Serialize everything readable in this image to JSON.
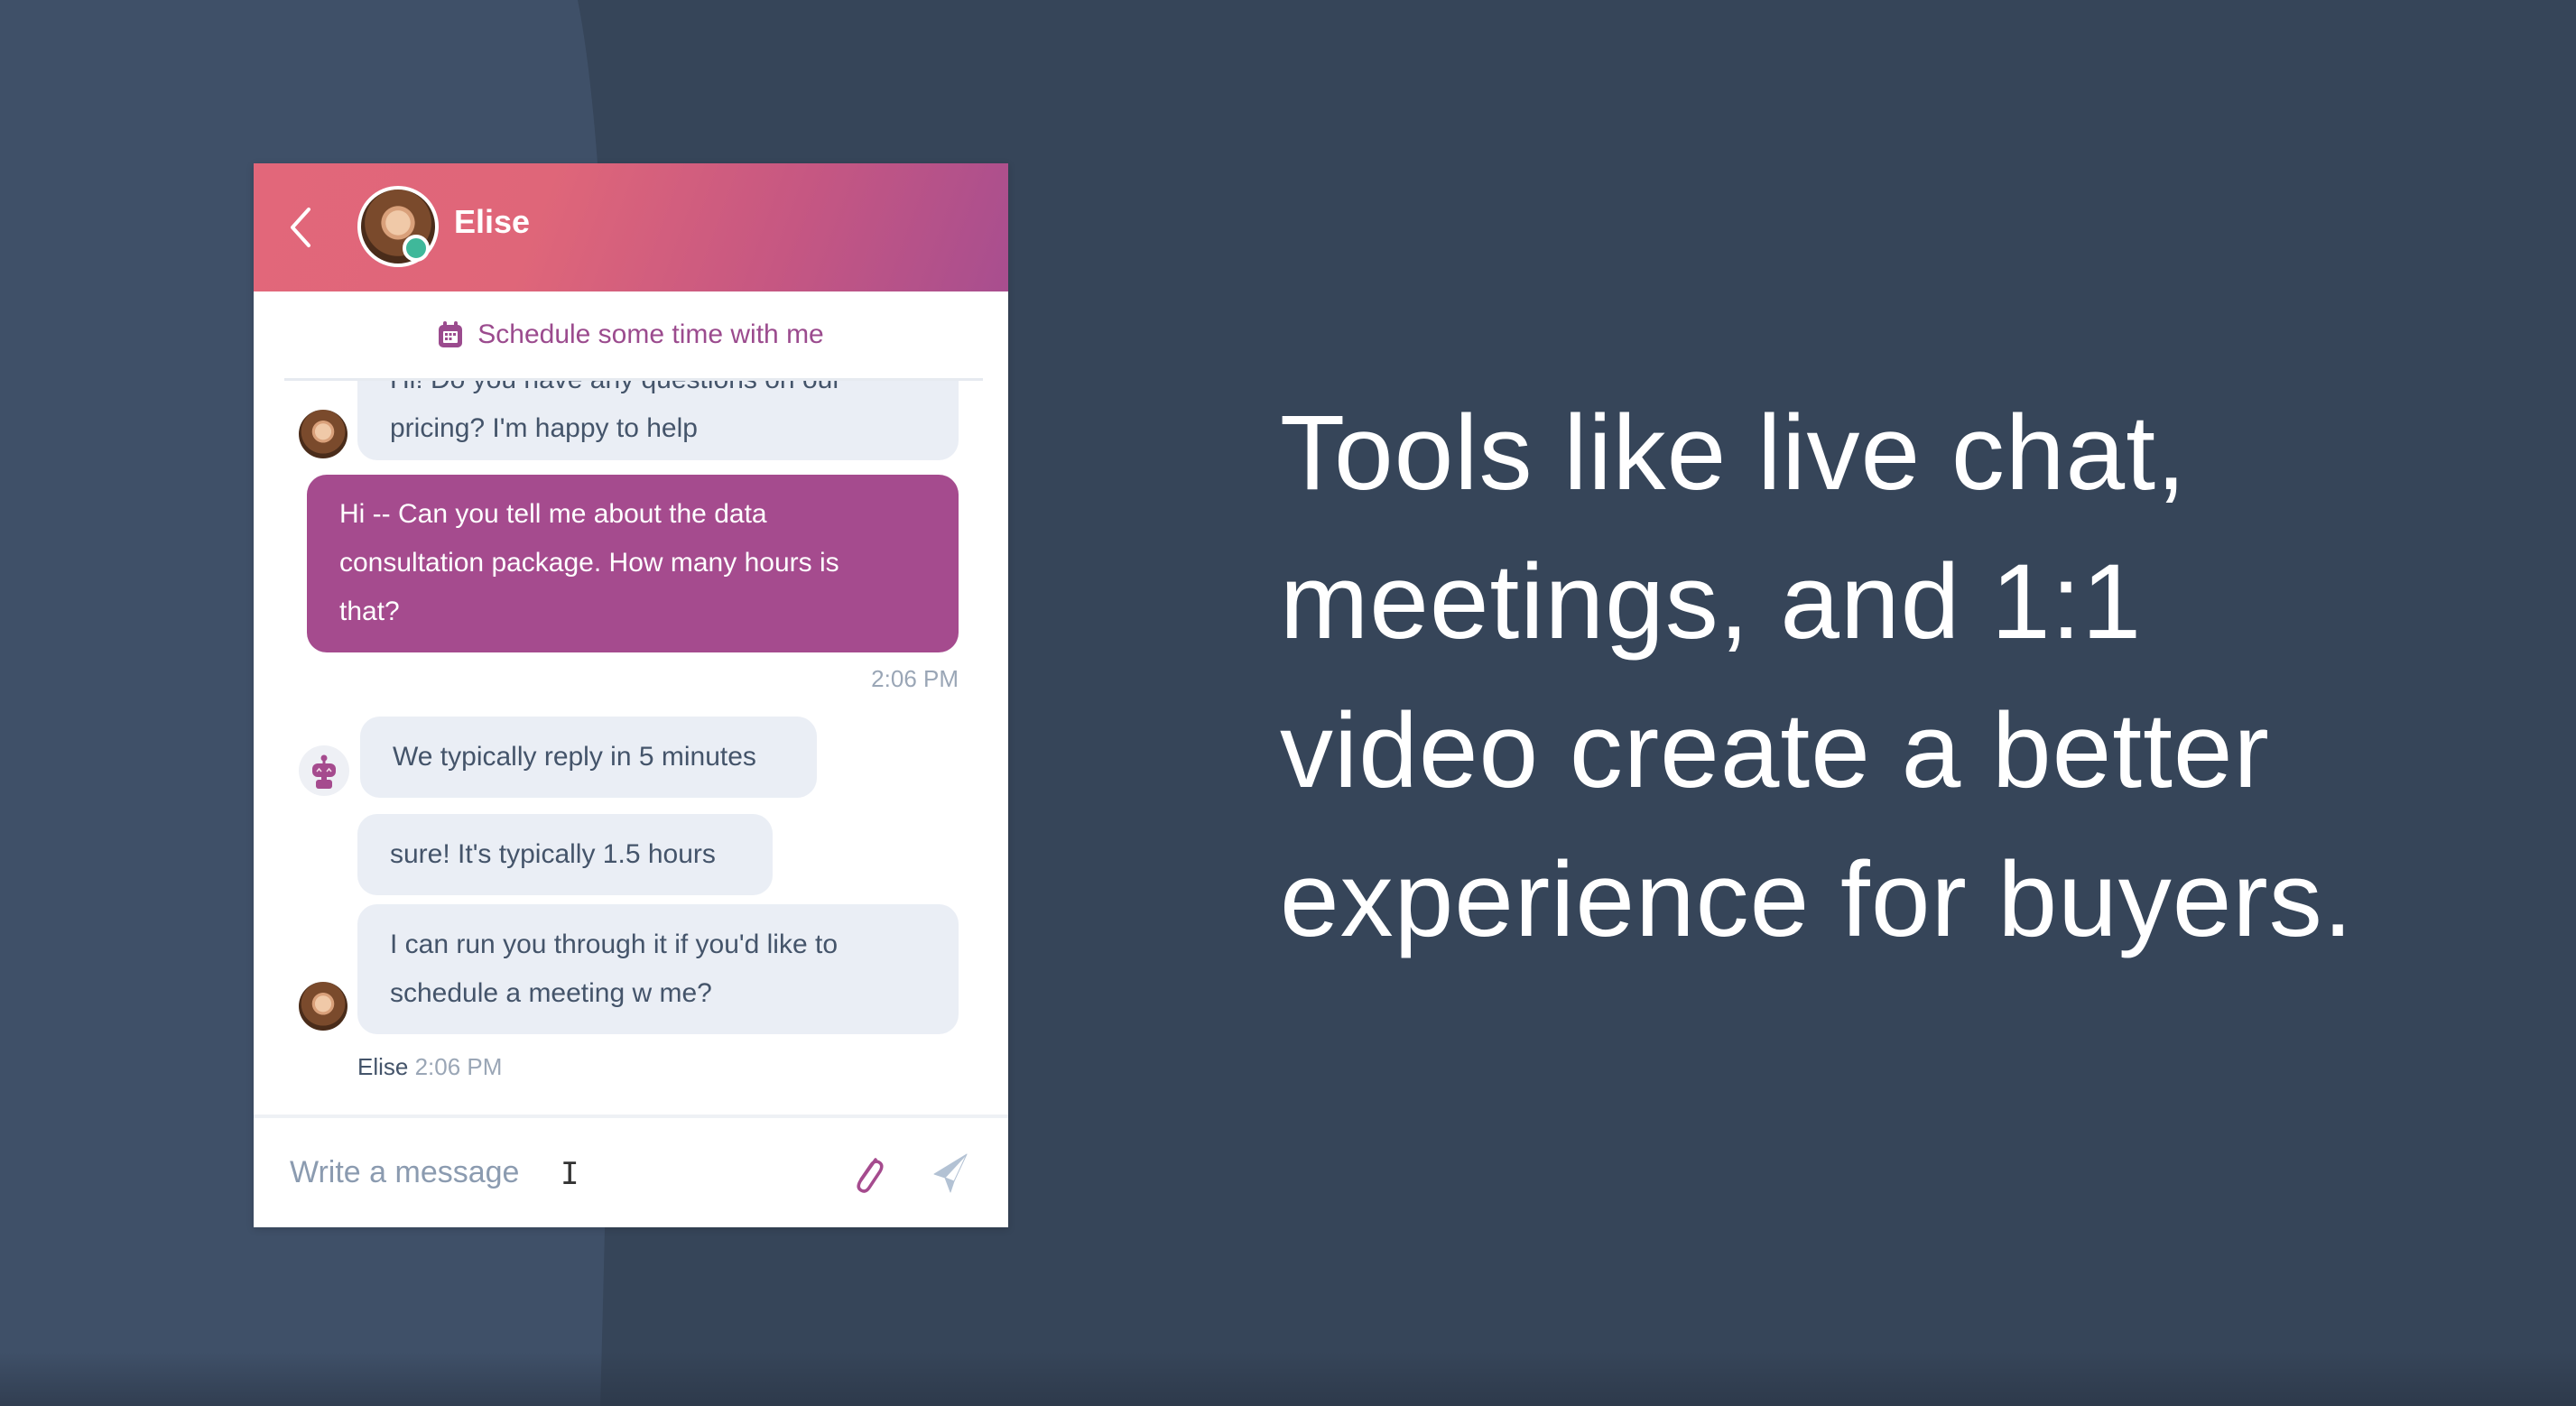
{
  "colors": {
    "background_left": "#3f5068",
    "background_right": "#364559",
    "header_gradient_start": "#e2677a",
    "header_gradient_end": "#a84e8f",
    "accent_purple": "#a54b8e",
    "status_online": "#3fb89a",
    "bubble_incoming": "#eaeef5",
    "text_dark": "#44546a",
    "text_muted": "#9aa6b6"
  },
  "chat": {
    "header": {
      "back_icon": "chevron-left-icon",
      "agent_name": "Elise",
      "status": "online"
    },
    "schedule": {
      "icon": "calendar-icon",
      "label": "Schedule some time with me"
    },
    "messages": [
      {
        "sender": "agent",
        "lines": [
          "Hi! Do you have any questions on our",
          "pricing? I'm happy to help"
        ]
      },
      {
        "sender": "visitor",
        "lines": [
          "Hi -- Can you tell me about the data",
          "consultation package. How many hours is",
          "that?"
        ],
        "time": "2:06 PM"
      },
      {
        "sender": "bot",
        "lines": [
          "We typically reply in 5 minutes"
        ]
      },
      {
        "sender": "agent",
        "lines": [
          "sure! It's typically 1.5 hours"
        ]
      },
      {
        "sender": "agent",
        "lines": [
          "I can run you through it if you'd like to",
          "schedule a meeting w me?"
        ],
        "sender_name": "Elise",
        "time": "2:06 PM"
      }
    ],
    "composer": {
      "placeholder": "Write a message",
      "value": "",
      "attach_icon": "paperclip-icon",
      "send_icon": "paper-plane-icon"
    }
  },
  "headline": {
    "lines": [
      "Tools like live chat,",
      "meetings, and 1:1",
      "video create a better",
      "experience for buyers."
    ]
  }
}
